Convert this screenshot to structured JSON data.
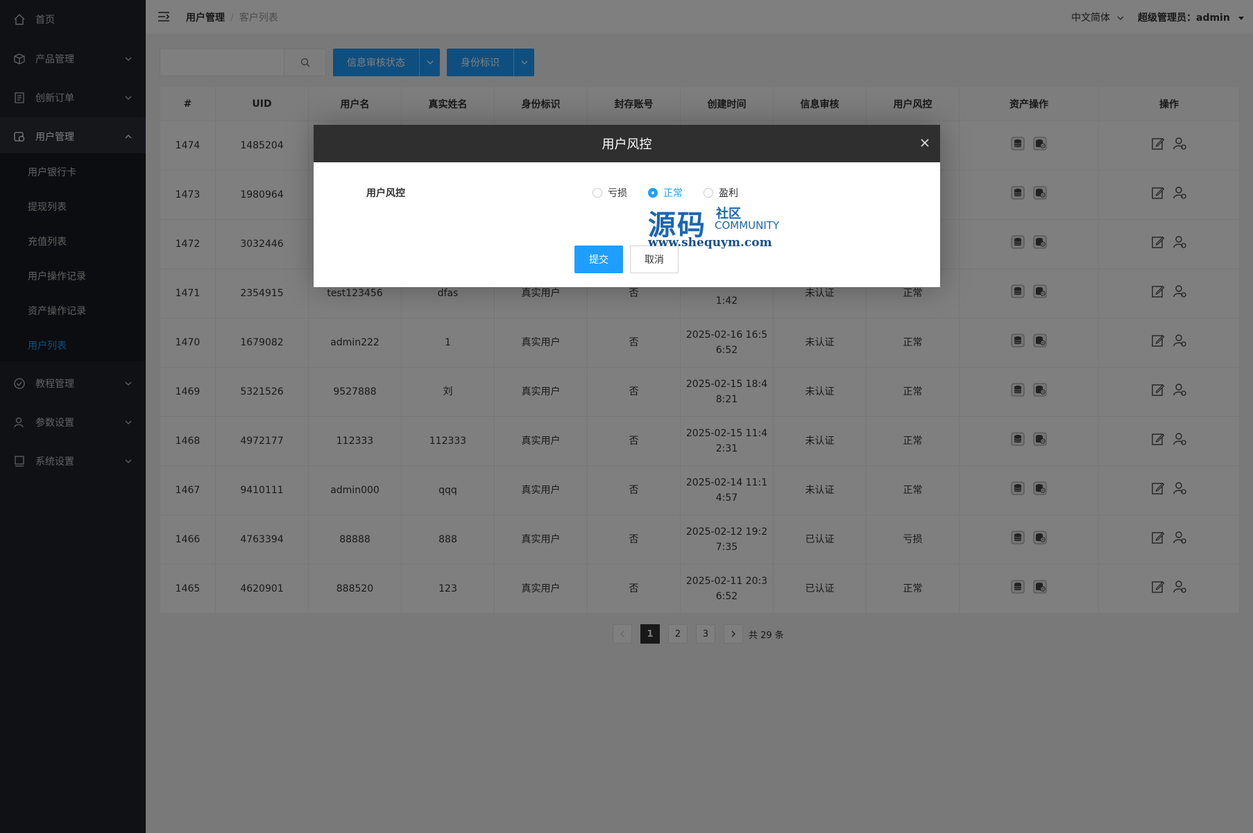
{
  "colors": {
    "accent": "#1e9fff",
    "sidebar_bg": "#20222a",
    "modal_title_bg": "#2f2f2f"
  },
  "sidebar": {
    "items": [
      {
        "label": "首页",
        "icon": "home-icon"
      },
      {
        "label": "产品管理",
        "icon": "box-icon"
      },
      {
        "label": "创新订单",
        "icon": "list-icon"
      },
      {
        "label": "用户管理",
        "icon": "users-icon"
      },
      {
        "label": "教程管理",
        "icon": "check-circle-icon"
      },
      {
        "label": "参数设置",
        "icon": "user-settings-icon"
      },
      {
        "label": "系统设置",
        "icon": "monitor-icon"
      }
    ],
    "sub_items": [
      "用户银行卡",
      "提现列表",
      "充值列表",
      "用户操作记录",
      "资产操作记录",
      "用户列表"
    ]
  },
  "header": {
    "breadcrumb": [
      "用户管理",
      "客户列表"
    ],
    "language": "中文简体",
    "user": "超级管理员：admin"
  },
  "toolbar": {
    "search_value": "",
    "filter1": "信息审核状态",
    "filter2": "身份标识"
  },
  "table": {
    "columns": [
      "#",
      "UID",
      "用户名",
      "真实姓名",
      "身份标识",
      "封存账号",
      "创建时间",
      "信息审核",
      "用户风控",
      "资产操作",
      "操作"
    ],
    "rows": [
      {
        "id": "1474",
        "uid": "1485204",
        "username": "",
        "realname": "",
        "identity": "",
        "frozen": "",
        "created_1": "",
        "created_2": "",
        "audit": "",
        "risk": ""
      },
      {
        "id": "1473",
        "uid": "1980964",
        "username": "",
        "realname": "",
        "identity": "",
        "frozen": "",
        "created_1": "",
        "created_2": "",
        "audit": "",
        "risk": ""
      },
      {
        "id": "1472",
        "uid": "3032446",
        "username": "",
        "realname": "",
        "identity": "",
        "frozen": "",
        "created_1": "",
        "created_2": "",
        "audit": "",
        "risk": ""
      },
      {
        "id": "1471",
        "uid": "2354915",
        "username": "test123456",
        "realname": "dfas",
        "identity": "真实用户",
        "frozen": "否",
        "created_1": "",
        "created_2": "1:42",
        "audit": "未认证",
        "risk": "正常"
      },
      {
        "id": "1470",
        "uid": "1679082",
        "username": "admin222",
        "realname": "1",
        "identity": "真实用户",
        "frozen": "否",
        "created_1": "2025-02-16 16:5",
        "created_2": "6:52",
        "audit": "未认证",
        "risk": "正常"
      },
      {
        "id": "1469",
        "uid": "5321526",
        "username": "9527888",
        "realname": "刘",
        "identity": "真实用户",
        "frozen": "否",
        "created_1": "2025-02-15 18:4",
        "created_2": "8:21",
        "audit": "未认证",
        "risk": "正常"
      },
      {
        "id": "1468",
        "uid": "4972177",
        "username": "112333",
        "realname": "112333",
        "identity": "真实用户",
        "frozen": "否",
        "created_1": "2025-02-15 11:4",
        "created_2": "2:31",
        "audit": "未认证",
        "risk": "正常"
      },
      {
        "id": "1467",
        "uid": "9410111",
        "username": "admin000",
        "realname": "qqq",
        "identity": "真实用户",
        "frozen": "否",
        "created_1": "2025-02-14 11:1",
        "created_2": "4:57",
        "audit": "未认证",
        "risk": "正常"
      },
      {
        "id": "1466",
        "uid": "4763394",
        "username": "88888",
        "realname": "888",
        "identity": "真实用户",
        "frozen": "否",
        "created_1": "2025-02-12 19:2",
        "created_2": "7:35",
        "audit": "已认证",
        "risk": "亏损"
      },
      {
        "id": "1465",
        "uid": "4620901",
        "username": "888520",
        "realname": "123",
        "identity": "真实用户",
        "frozen": "否",
        "created_1": "2025-02-11 20:3",
        "created_2": "6:52",
        "audit": "已认证",
        "risk": "正常"
      }
    ]
  },
  "pagination": {
    "pages": [
      "1",
      "2",
      "3"
    ],
    "current": "1",
    "total": "共 29 条"
  },
  "modal": {
    "title": "用户风控",
    "field_label": "用户风控",
    "options": [
      {
        "label": "亏损",
        "checked": false
      },
      {
        "label": "正常",
        "checked": true
      },
      {
        "label": "盈利",
        "checked": false
      }
    ],
    "submit": "提交",
    "cancel": "取消"
  },
  "watermark": {
    "big": "源码",
    "small1": "社区",
    "small2": "COMMUNITY",
    "url": "www.shequym.com"
  }
}
